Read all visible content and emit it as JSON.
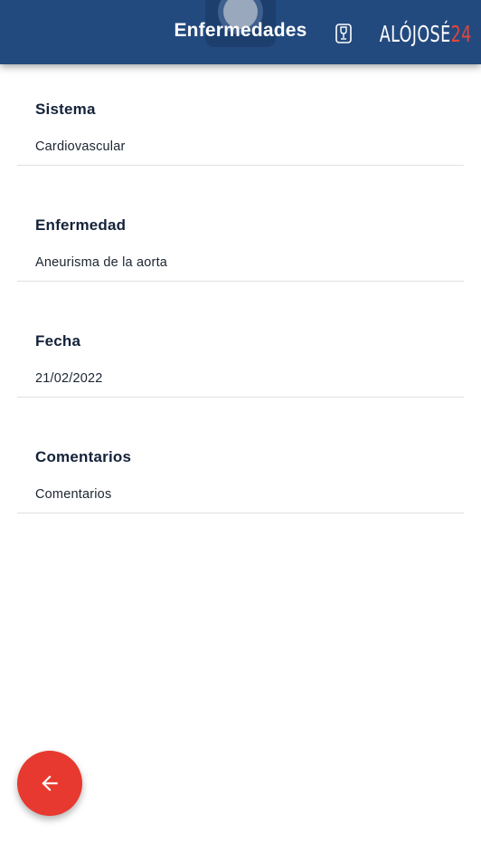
{
  "header": {
    "title": "Enfermedades",
    "logo_text_main": "ALÓJOSÉ",
    "logo_text_accent": "24",
    "logo_icon": "wine-glass-icon",
    "background_color": "#234a7e",
    "accent_color": "#e0473c"
  },
  "fields": [
    {
      "label": "Sistema",
      "value": "Cardiovascular"
    },
    {
      "label": "Enfermedad",
      "value": "Aneurisma de la aorta"
    },
    {
      "label": "Fecha",
      "value": "21/02/2022"
    },
    {
      "label": "Comentarios",
      "value": "Comentarios"
    }
  ],
  "fab": {
    "icon": "arrow-left-icon",
    "color": "#e7392f"
  }
}
